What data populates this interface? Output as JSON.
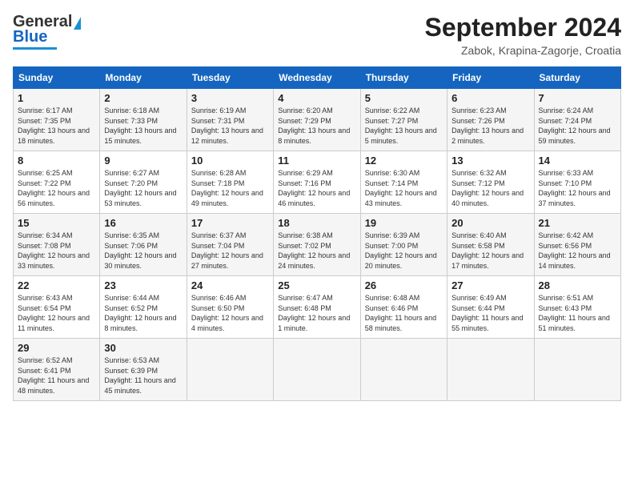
{
  "header": {
    "logo_general": "General",
    "logo_blue": "Blue",
    "month_title": "September 2024",
    "location": "Zabok, Krapina-Zagorje, Croatia"
  },
  "days_of_week": [
    "Sunday",
    "Monday",
    "Tuesday",
    "Wednesday",
    "Thursday",
    "Friday",
    "Saturday"
  ],
  "weeks": [
    [
      {
        "day": 1,
        "sunrise": "6:17 AM",
        "sunset": "7:35 PM",
        "daylight": "13 hours and 18 minutes."
      },
      {
        "day": 2,
        "sunrise": "6:18 AM",
        "sunset": "7:33 PM",
        "daylight": "13 hours and 15 minutes."
      },
      {
        "day": 3,
        "sunrise": "6:19 AM",
        "sunset": "7:31 PM",
        "daylight": "13 hours and 12 minutes."
      },
      {
        "day": 4,
        "sunrise": "6:20 AM",
        "sunset": "7:29 PM",
        "daylight": "13 hours and 8 minutes."
      },
      {
        "day": 5,
        "sunrise": "6:22 AM",
        "sunset": "7:27 PM",
        "daylight": "13 hours and 5 minutes."
      },
      {
        "day": 6,
        "sunrise": "6:23 AM",
        "sunset": "7:26 PM",
        "daylight": "13 hours and 2 minutes."
      },
      {
        "day": 7,
        "sunrise": "6:24 AM",
        "sunset": "7:24 PM",
        "daylight": "12 hours and 59 minutes."
      }
    ],
    [
      {
        "day": 8,
        "sunrise": "6:25 AM",
        "sunset": "7:22 PM",
        "daylight": "12 hours and 56 minutes."
      },
      {
        "day": 9,
        "sunrise": "6:27 AM",
        "sunset": "7:20 PM",
        "daylight": "12 hours and 53 minutes."
      },
      {
        "day": 10,
        "sunrise": "6:28 AM",
        "sunset": "7:18 PM",
        "daylight": "12 hours and 49 minutes."
      },
      {
        "day": 11,
        "sunrise": "6:29 AM",
        "sunset": "7:16 PM",
        "daylight": "12 hours and 46 minutes."
      },
      {
        "day": 12,
        "sunrise": "6:30 AM",
        "sunset": "7:14 PM",
        "daylight": "12 hours and 43 minutes."
      },
      {
        "day": 13,
        "sunrise": "6:32 AM",
        "sunset": "7:12 PM",
        "daylight": "12 hours and 40 minutes."
      },
      {
        "day": 14,
        "sunrise": "6:33 AM",
        "sunset": "7:10 PM",
        "daylight": "12 hours and 37 minutes."
      }
    ],
    [
      {
        "day": 15,
        "sunrise": "6:34 AM",
        "sunset": "7:08 PM",
        "daylight": "12 hours and 33 minutes."
      },
      {
        "day": 16,
        "sunrise": "6:35 AM",
        "sunset": "7:06 PM",
        "daylight": "12 hours and 30 minutes."
      },
      {
        "day": 17,
        "sunrise": "6:37 AM",
        "sunset": "7:04 PM",
        "daylight": "12 hours and 27 minutes."
      },
      {
        "day": 18,
        "sunrise": "6:38 AM",
        "sunset": "7:02 PM",
        "daylight": "12 hours and 24 minutes."
      },
      {
        "day": 19,
        "sunrise": "6:39 AM",
        "sunset": "7:00 PM",
        "daylight": "12 hours and 20 minutes."
      },
      {
        "day": 20,
        "sunrise": "6:40 AM",
        "sunset": "6:58 PM",
        "daylight": "12 hours and 17 minutes."
      },
      {
        "day": 21,
        "sunrise": "6:42 AM",
        "sunset": "6:56 PM",
        "daylight": "12 hours and 14 minutes."
      }
    ],
    [
      {
        "day": 22,
        "sunrise": "6:43 AM",
        "sunset": "6:54 PM",
        "daylight": "12 hours and 11 minutes."
      },
      {
        "day": 23,
        "sunrise": "6:44 AM",
        "sunset": "6:52 PM",
        "daylight": "12 hours and 8 minutes."
      },
      {
        "day": 24,
        "sunrise": "6:46 AM",
        "sunset": "6:50 PM",
        "daylight": "12 hours and 4 minutes."
      },
      {
        "day": 25,
        "sunrise": "6:47 AM",
        "sunset": "6:48 PM",
        "daylight": "12 hours and 1 minute."
      },
      {
        "day": 26,
        "sunrise": "6:48 AM",
        "sunset": "6:46 PM",
        "daylight": "11 hours and 58 minutes."
      },
      {
        "day": 27,
        "sunrise": "6:49 AM",
        "sunset": "6:44 PM",
        "daylight": "11 hours and 55 minutes."
      },
      {
        "day": 28,
        "sunrise": "6:51 AM",
        "sunset": "6:43 PM",
        "daylight": "11 hours and 51 minutes."
      }
    ],
    [
      {
        "day": 29,
        "sunrise": "6:52 AM",
        "sunset": "6:41 PM",
        "daylight": "11 hours and 48 minutes."
      },
      {
        "day": 30,
        "sunrise": "6:53 AM",
        "sunset": "6:39 PM",
        "daylight": "11 hours and 45 minutes."
      },
      null,
      null,
      null,
      null,
      null
    ]
  ]
}
